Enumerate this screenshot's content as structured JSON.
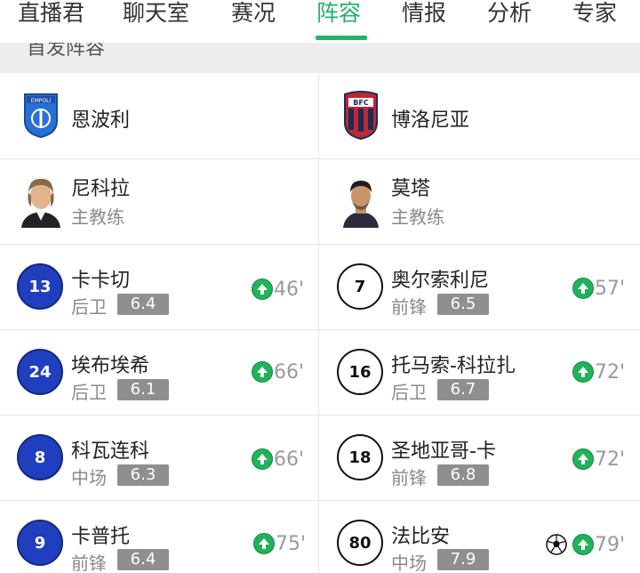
{
  "tabs": [
    {
      "label": "直播君"
    },
    {
      "label": "聊天室"
    },
    {
      "label": "赛况"
    },
    {
      "label": "阵容"
    },
    {
      "label": "情报"
    },
    {
      "label": "分析"
    },
    {
      "label": "专家"
    }
  ],
  "active_tab": "阵容",
  "section": {
    "title": "首发阵容"
  },
  "teams": {
    "home": {
      "name": "恩波利",
      "coach": {
        "name": "尼科拉",
        "role": "主教练"
      }
    },
    "away": {
      "name": "博洛尼亚",
      "coach": {
        "name": "莫塔",
        "role": "主教练"
      }
    }
  },
  "players": {
    "home": [
      {
        "number": "13",
        "name": "卡卡切",
        "position": "后卫",
        "rating": "6.4",
        "sub_minute": "46'"
      },
      {
        "number": "24",
        "name": "埃布埃希",
        "position": "后卫",
        "rating": "6.1",
        "sub_minute": "66'"
      },
      {
        "number": "8",
        "name": "科瓦连科",
        "position": "中场",
        "rating": "6.3",
        "sub_minute": "66'"
      },
      {
        "number": "9",
        "name": "卡普托",
        "position": "前锋",
        "rating": "6.4",
        "sub_minute": "75'"
      }
    ],
    "away": [
      {
        "number": "7",
        "name": "奥尔索利尼",
        "position": "前锋",
        "rating": "6.5",
        "sub_minute": "57'"
      },
      {
        "number": "16",
        "name": "托马索-科拉扎",
        "position": "后卫",
        "rating": "6.7",
        "sub_minute": "72'"
      },
      {
        "number": "18",
        "name": "圣地亚哥-卡",
        "position": "前锋",
        "rating": "6.8",
        "sub_minute": "72'"
      },
      {
        "number": "80",
        "name": "法比安",
        "position": "中场",
        "rating": "7.9",
        "sub_minute": "79'"
      }
    ]
  },
  "colors": {
    "accent": "#21b36a",
    "home_badge": "#1f3fbf",
    "rating_bg": "#8f8f8f",
    "sub_arrow": "#22b25a"
  }
}
